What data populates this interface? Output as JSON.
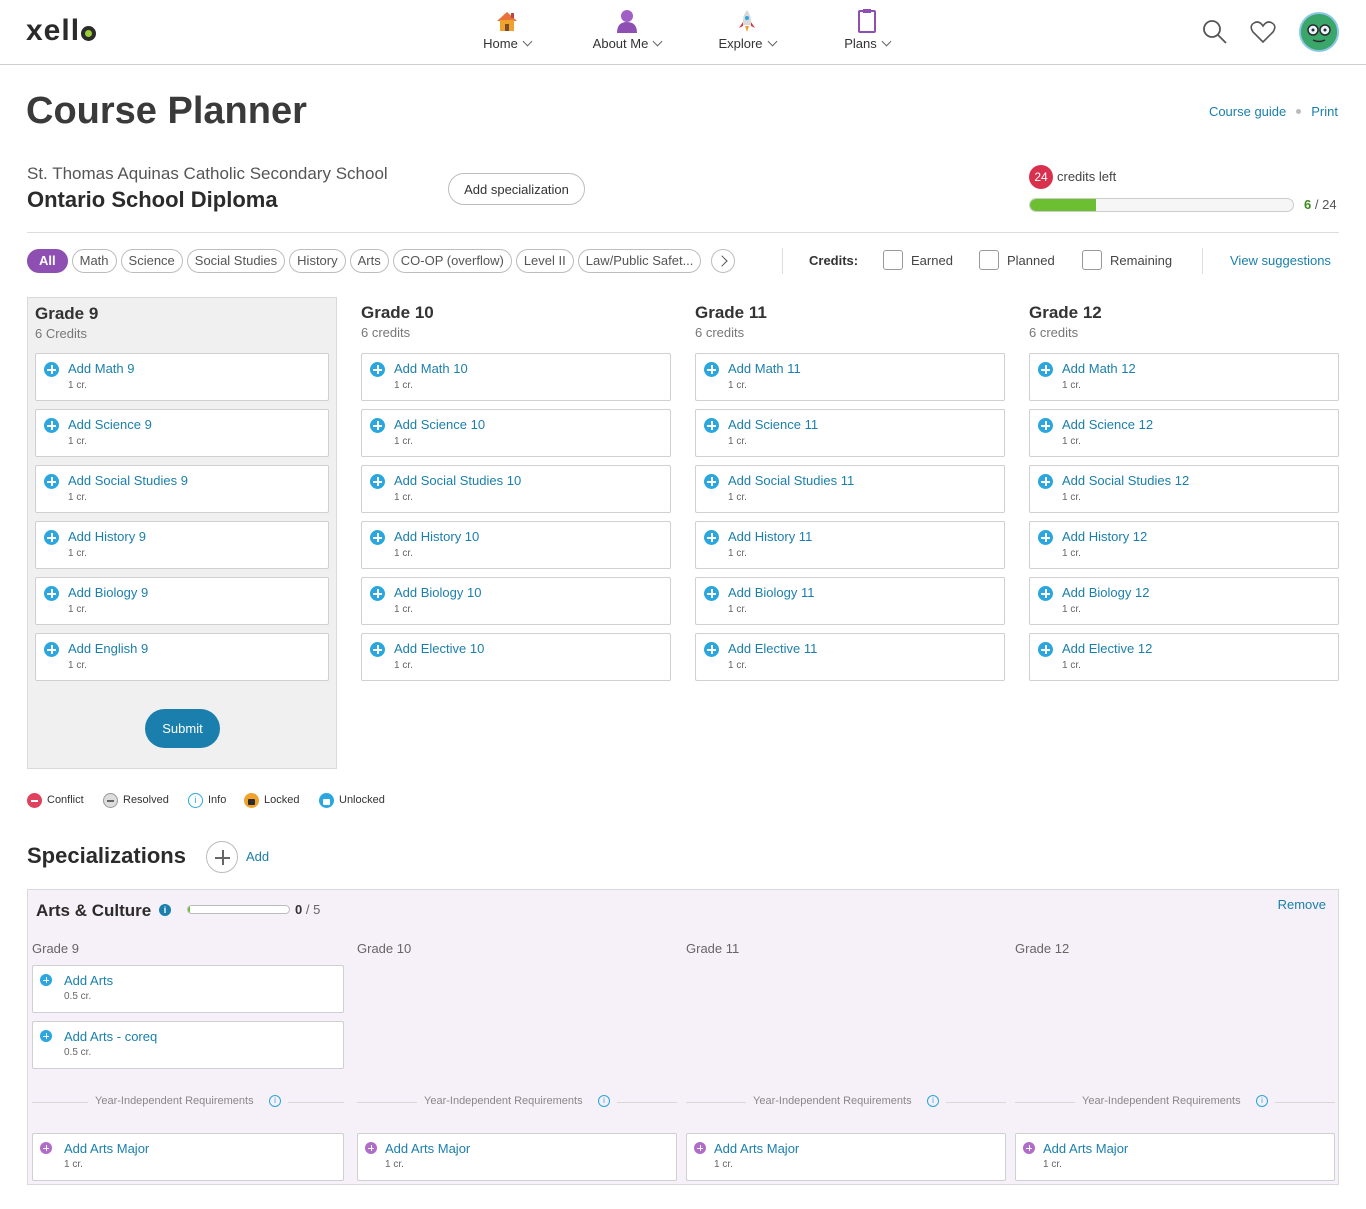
{
  "nav": {
    "logo": "xello",
    "items": [
      {
        "label": "Home",
        "icon": "house-icon"
      },
      {
        "label": "About Me",
        "icon": "person-icon"
      },
      {
        "label": "Explore",
        "icon": "rocket-icon"
      },
      {
        "label": "Plans",
        "icon": "clipboard-icon"
      }
    ],
    "icons": [
      "search-icon",
      "heart-icon",
      "avatar"
    ]
  },
  "header": {
    "title": "Course Planner",
    "links": [
      "Course guide",
      "Print"
    ],
    "school": "St. Thomas Aquinas Catholic Secondary School",
    "diploma": "Ontario School Diploma",
    "add_specialization": "Add specialization",
    "credits_left_num": "24",
    "credits_left_label": "credits left",
    "credits_earned": "6",
    "credits_total": "/ 24",
    "credits_progress": 0.25
  },
  "filters": {
    "chips": [
      "All",
      "Math",
      "Science",
      "Social Studies",
      "History",
      "Arts",
      "CO-OP (overflow)",
      "Level II",
      "Law/Public Safet..."
    ],
    "credits_label": "Credits:",
    "checkboxes": [
      "Earned",
      "Planned",
      "Remaining"
    ],
    "view_suggestions": "View suggestions"
  },
  "grades": [
    {
      "title": "Grade 9",
      "credits": "6 Credits",
      "courses": [
        {
          "name": "Add Math 9",
          "cr": "1 cr."
        },
        {
          "name": "Add Science 9",
          "cr": "1 cr."
        },
        {
          "name": "Add Social Studies 9",
          "cr": "1 cr."
        },
        {
          "name": "Add History 9",
          "cr": "1 cr."
        },
        {
          "name": "Add Biology 9",
          "cr": "1 cr."
        },
        {
          "name": "Add English 9",
          "cr": "1 cr."
        }
      ]
    },
    {
      "title": "Grade 10",
      "credits": "6 credits",
      "courses": [
        {
          "name": "Add Math 10",
          "cr": "1 cr."
        },
        {
          "name": "Add Science 10",
          "cr": "1 cr."
        },
        {
          "name": "Add Social Studies 10",
          "cr": "1 cr."
        },
        {
          "name": "Add History 10",
          "cr": "1 cr."
        },
        {
          "name": "Add Biology 10",
          "cr": "1 cr."
        },
        {
          "name": "Add Elective 10",
          "cr": "1 cr."
        }
      ]
    },
    {
      "title": "Grade 11",
      "credits": "6 credits",
      "courses": [
        {
          "name": "Add Math 11",
          "cr": "1 cr."
        },
        {
          "name": "Add Science 11",
          "cr": "1 cr."
        },
        {
          "name": "Add Social Studies 11",
          "cr": "1 cr."
        },
        {
          "name": "Add History 11",
          "cr": "1 cr."
        },
        {
          "name": "Add Biology 11",
          "cr": "1 cr."
        },
        {
          "name": "Add Elective 11",
          "cr": "1 cr."
        }
      ]
    },
    {
      "title": "Grade 12",
      "credits": "6 credits",
      "courses": [
        {
          "name": "Add Math 12",
          "cr": "1 cr."
        },
        {
          "name": "Add Science 12",
          "cr": "1 cr."
        },
        {
          "name": "Add Social Studies 12",
          "cr": "1 cr."
        },
        {
          "name": "Add History 12",
          "cr": "1 cr."
        },
        {
          "name": "Add Biology 12",
          "cr": "1 cr."
        },
        {
          "name": "Add Elective 12",
          "cr": "1 cr."
        }
      ]
    }
  ],
  "submit": "Submit",
  "legend": [
    "Conflict",
    "Resolved",
    "Info",
    "Locked",
    "Unlocked"
  ],
  "specializations": {
    "title": "Specializations",
    "add": "Add",
    "panel": {
      "name": "Arts & Culture",
      "info": "i",
      "progress_done": "0",
      "progress_total": "/ 5",
      "progress": 0.02,
      "remove": "Remove",
      "grades": [
        "Grade 9",
        "Grade 10",
        "Grade 11",
        "Grade 12"
      ],
      "grade9_courses": [
        {
          "name": "Add Arts",
          "cr": "0.5 cr."
        },
        {
          "name": "Add Arts - coreq",
          "cr": "0.5 cr."
        }
      ],
      "year_independent": "Year-Independent Requirements",
      "majors": [
        {
          "name": "Add Arts Major",
          "cr": "1 cr."
        },
        {
          "name": "Add Arts Major",
          "cr": "1 cr."
        },
        {
          "name": "Add Arts Major",
          "cr": "1 cr."
        },
        {
          "name": "Add Arts Major",
          "cr": "1 cr."
        }
      ]
    }
  },
  "colors": {
    "accent": "#1a7fad",
    "filter_active": "#8e4fb3",
    "progress": "#6cbf30",
    "conflict": "#e0425e",
    "locked": "#f0a22e"
  }
}
